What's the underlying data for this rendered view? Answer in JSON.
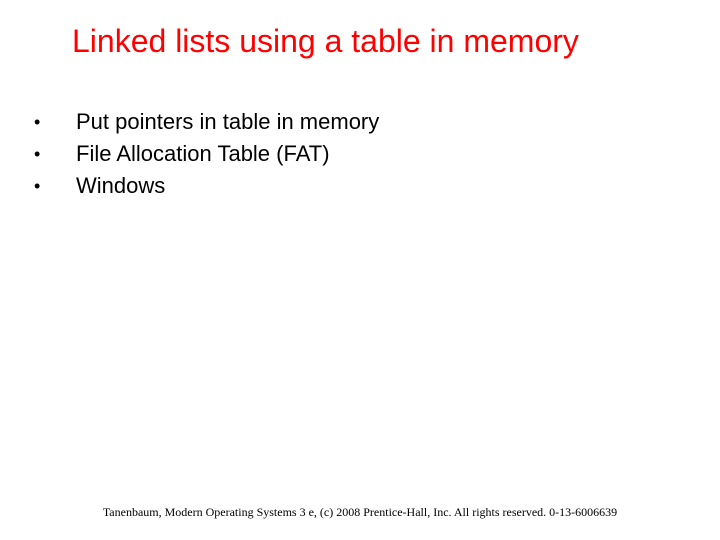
{
  "title": "Linked lists using a table in memory",
  "bullets": [
    "Put pointers in table in memory",
    "File Allocation Table (FAT)",
    "Windows"
  ],
  "footer": "Tanenbaum, Modern Operating Systems 3 e, (c) 2008 Prentice-Hall, Inc. All rights reserved. 0-13-6006639"
}
